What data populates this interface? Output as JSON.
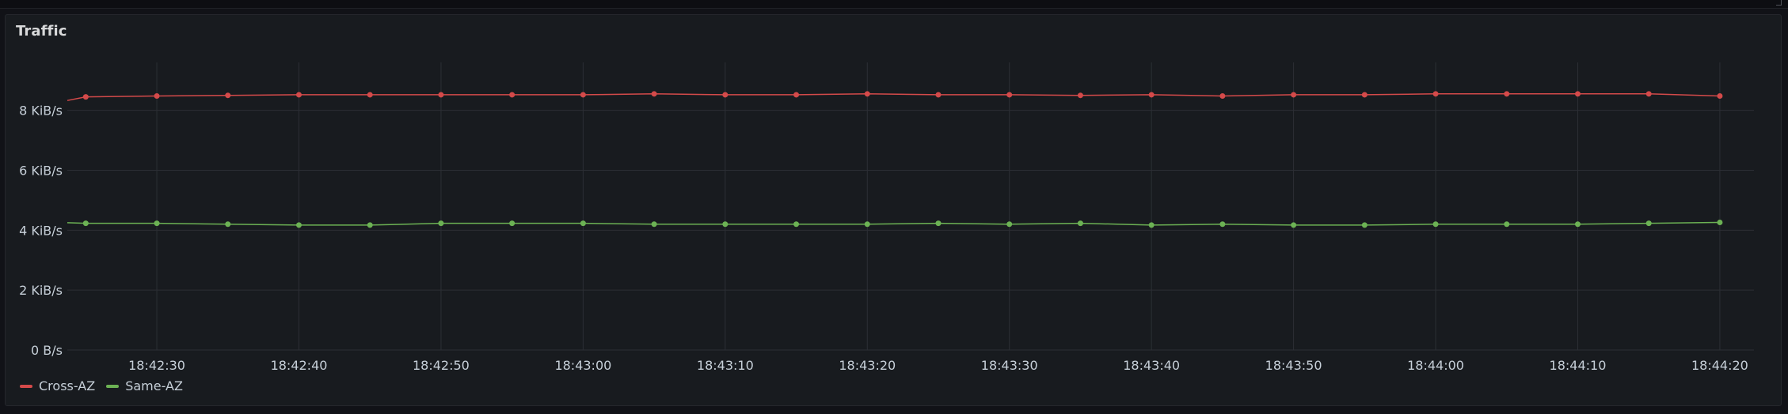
{
  "panel": {
    "title": "Traffic"
  },
  "colors": {
    "background": "#111217",
    "panel_bg": "#181b1f",
    "grid": "#2c2f35",
    "text": "#c7d0d9",
    "cross_az": "#d44a4a",
    "same_az": "#6cb254"
  },
  "chart_data": {
    "type": "line",
    "ylim": [
      0,
      9.6
    ],
    "y_ticks": [
      {
        "value": 0,
        "label": "0 B/s"
      },
      {
        "value": 2,
        "label": "2 KiB/s"
      },
      {
        "value": 4,
        "label": "4 KiB/s"
      },
      {
        "value": 6,
        "label": "6 KiB/s"
      },
      {
        "value": 8,
        "label": "8 KiB/s"
      }
    ],
    "x_ticks": [
      "18:42:30",
      "18:42:40",
      "18:42:50",
      "18:43:00",
      "18:43:10",
      "18:43:20",
      "18:43:30",
      "18:43:40",
      "18:43:50",
      "18:44:00",
      "18:44:10",
      "18:44:20"
    ],
    "x_tick_seconds": [
      30,
      40,
      50,
      60,
      70,
      80,
      90,
      100,
      110,
      120,
      130,
      140
    ],
    "x_range_seconds": [
      23.7,
      142.4
    ],
    "grid": true,
    "legend_position": "bottom-left",
    "series": [
      {
        "name": "Cross-AZ",
        "line_start": {
          "x": 23.7,
          "y": 8.33
        },
        "points": [
          {
            "x": 25,
            "y": 8.45
          },
          {
            "x": 30,
            "y": 8.48
          },
          {
            "x": 35,
            "y": 8.5
          },
          {
            "x": 40,
            "y": 8.52
          },
          {
            "x": 45,
            "y": 8.52
          },
          {
            "x": 50,
            "y": 8.52
          },
          {
            "x": 55,
            "y": 8.52
          },
          {
            "x": 60,
            "y": 8.52
          },
          {
            "x": 65,
            "y": 8.55
          },
          {
            "x": 70,
            "y": 8.52
          },
          {
            "x": 75,
            "y": 8.52
          },
          {
            "x": 80,
            "y": 8.55
          },
          {
            "x": 85,
            "y": 8.52
          },
          {
            "x": 90,
            "y": 8.52
          },
          {
            "x": 95,
            "y": 8.5
          },
          {
            "x": 100,
            "y": 8.52
          },
          {
            "x": 105,
            "y": 8.48
          },
          {
            "x": 110,
            "y": 8.52
          },
          {
            "x": 115,
            "y": 8.52
          },
          {
            "x": 120,
            "y": 8.55
          },
          {
            "x": 125,
            "y": 8.55
          },
          {
            "x": 130,
            "y": 8.55
          },
          {
            "x": 135,
            "y": 8.55
          },
          {
            "x": 140,
            "y": 8.48
          }
        ]
      },
      {
        "name": "Same-AZ",
        "line_start": {
          "x": 23.7,
          "y": 4.25
        },
        "points": [
          {
            "x": 25,
            "y": 4.23
          },
          {
            "x": 30,
            "y": 4.23
          },
          {
            "x": 35,
            "y": 4.2
          },
          {
            "x": 40,
            "y": 4.17
          },
          {
            "x": 45,
            "y": 4.17
          },
          {
            "x": 50,
            "y": 4.23
          },
          {
            "x": 55,
            "y": 4.23
          },
          {
            "x": 60,
            "y": 4.23
          },
          {
            "x": 65,
            "y": 4.2
          },
          {
            "x": 70,
            "y": 4.2
          },
          {
            "x": 75,
            "y": 4.2
          },
          {
            "x": 80,
            "y": 4.2
          },
          {
            "x": 85,
            "y": 4.23
          },
          {
            "x": 90,
            "y": 4.2
          },
          {
            "x": 95,
            "y": 4.23
          },
          {
            "x": 100,
            "y": 4.17
          },
          {
            "x": 105,
            "y": 4.2
          },
          {
            "x": 110,
            "y": 4.17
          },
          {
            "x": 115,
            "y": 4.17
          },
          {
            "x": 120,
            "y": 4.2
          },
          {
            "x": 125,
            "y": 4.2
          },
          {
            "x": 130,
            "y": 4.2
          },
          {
            "x": 135,
            "y": 4.23
          },
          {
            "x": 140,
            "y": 4.26
          }
        ]
      }
    ]
  }
}
